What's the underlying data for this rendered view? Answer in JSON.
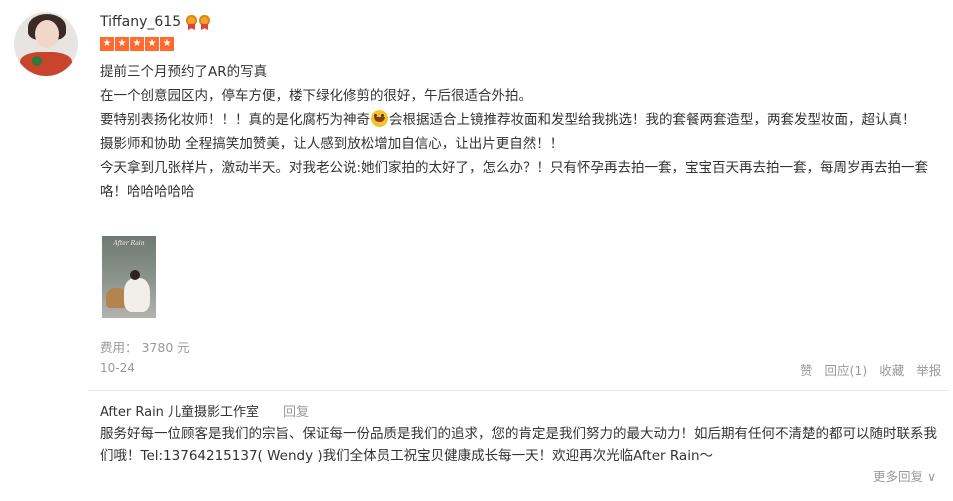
{
  "user": {
    "name": "Tiffany_615",
    "medal_icons": [
      "medal-icon",
      "medal-icon"
    ],
    "rating_stars": 5,
    "star_color": "#ff6a2e"
  },
  "review": {
    "lines": [
      "提前三个月预约了AR的写真",
      "在一个创意园区内，停车方便，楼下绿化修剪的很好，午后很适合外拍。",
      "要特别表扬化妆师！！！真的是化腐朽为神奇",
      "会根据适合上镜推荐妆面和发型给我挑选！我的套餐两套造型，两套发型妆面，超认真！",
      "摄影师和协助 全程搞笑加赞美，让人感到放松增加自信心，让出片更自然！！",
      "今天拿到几张样片，激动半天。对我老公说:她们家拍的太好了，怎么办？！只有怀孕再去拍一套，宝宝百天再去拍一套，每周岁再去拍一套咯！哈哈哈哈哈"
    ],
    "photo_watermark": "After Rain",
    "fee": "费用： 3780 元",
    "date": "10-24"
  },
  "actions": {
    "like": "赞",
    "reply": "回应(1)",
    "favorite": "收藏",
    "report": "举报"
  },
  "merchant_reply": {
    "shop_name": "After Rain 儿童摄影工作室",
    "reply_label": "回复",
    "text": "服务好每一位顾客是我们的宗旨、保证每一份品质是我们的追求，您的肯定是我们努力的最大动力！如后期有任何不清楚的都可以随时联系我们哦！Tel:13764215137( Wendy )我们全体员工祝宝贝健康成长每一天！欢迎再次光临After Rain～",
    "more": "更多回复 ∨"
  }
}
